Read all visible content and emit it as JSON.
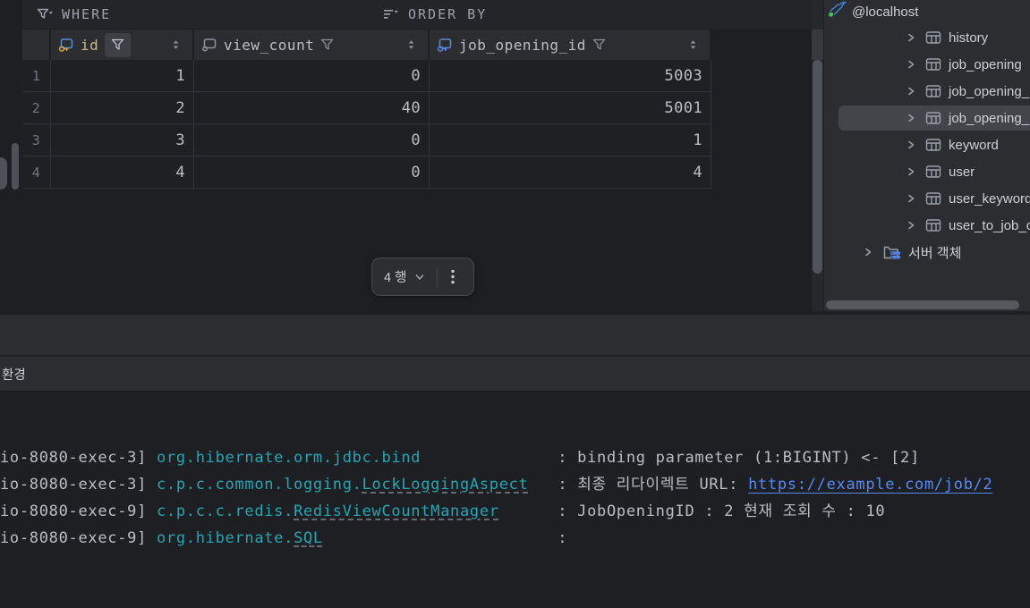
{
  "query_bar": {
    "where_label": "WHERE",
    "order_by_label": "ORDER BY"
  },
  "grid": {
    "columns": [
      {
        "name": "id",
        "key": "primary",
        "filter_boxed": true
      },
      {
        "name": "view_count",
        "key": "none",
        "filter_boxed": false
      },
      {
        "name": "job_opening_id",
        "key": "foreign",
        "filter_boxed": false
      }
    ],
    "rows": [
      {
        "num": "1",
        "cells": [
          "1",
          "0",
          "5003"
        ]
      },
      {
        "num": "2",
        "cells": [
          "2",
          "40",
          "5001"
        ]
      },
      {
        "num": "3",
        "cells": [
          "3",
          "0",
          "1"
        ]
      },
      {
        "num": "4",
        "cells": [
          "4",
          "0",
          "4"
        ]
      }
    ]
  },
  "pagination": {
    "row_count_label": "4 행"
  },
  "sidebar": {
    "root_label": "@localhost",
    "tables": [
      {
        "label": "history",
        "selected": false
      },
      {
        "label": "job_opening",
        "selected": false
      },
      {
        "label": "job_opening_",
        "selected": false
      },
      {
        "label": "job_opening_",
        "selected": true
      },
      {
        "label": "keyword",
        "selected": false
      },
      {
        "label": "user",
        "selected": false
      },
      {
        "label": "user_keyword",
        "selected": false
      },
      {
        "label": "user_to_job_o",
        "selected": false
      }
    ],
    "server_objects_label": "서버 객체"
  },
  "bottom": {
    "tab_label": "환경"
  },
  "console": {
    "lines": [
      {
        "segments": [
          {
            "text": "io-8080-exec-3] ",
            "style": "plain"
          },
          {
            "text": "org.hibernate.orm.jdbc.bind",
            "style": "logger"
          },
          {
            "text": "              : binding parameter (1:BIGINT) <- [2]",
            "style": "plain"
          }
        ]
      },
      {
        "segments": [
          {
            "text": "io-8080-exec-3] ",
            "style": "plain"
          },
          {
            "text": "c.p.c.common.logging.",
            "style": "logger"
          },
          {
            "text": "LockLoggingAspect",
            "style": "logger-link"
          },
          {
            "text": "   : 최종 리다이렉트 URL: ",
            "style": "plain"
          },
          {
            "text": "https://example.com/job/2",
            "style": "url"
          }
        ]
      },
      {
        "segments": [
          {
            "text": "io-8080-exec-9] ",
            "style": "plain"
          },
          {
            "text": "c.p.c.c.redis.",
            "style": "logger"
          },
          {
            "text": "RedisViewCountManager",
            "style": "logger-link"
          },
          {
            "text": "      : JobOpeningID : 2 현재 조회 수 : 10",
            "style": "plain"
          }
        ]
      },
      {
        "segments": [
          {
            "text": "io-8080-exec-9] ",
            "style": "plain"
          },
          {
            "text": "org.hibernate.",
            "style": "logger"
          },
          {
            "text": "SQL",
            "style": "logger-link"
          },
          {
            "text": "                        : ",
            "style": "plain"
          }
        ]
      }
    ]
  },
  "colors": {
    "editor_bg": "#1e1f22",
    "panel_bg": "#2b2d30",
    "selection": "#43454a",
    "accent_teal": "#24a6b4",
    "link_blue": "#548af7",
    "pk_gold": "#cfa144",
    "fk_blue": "#4f83e6",
    "mysql_blue": "#3b82d8",
    "connected_green": "#4fb857"
  }
}
